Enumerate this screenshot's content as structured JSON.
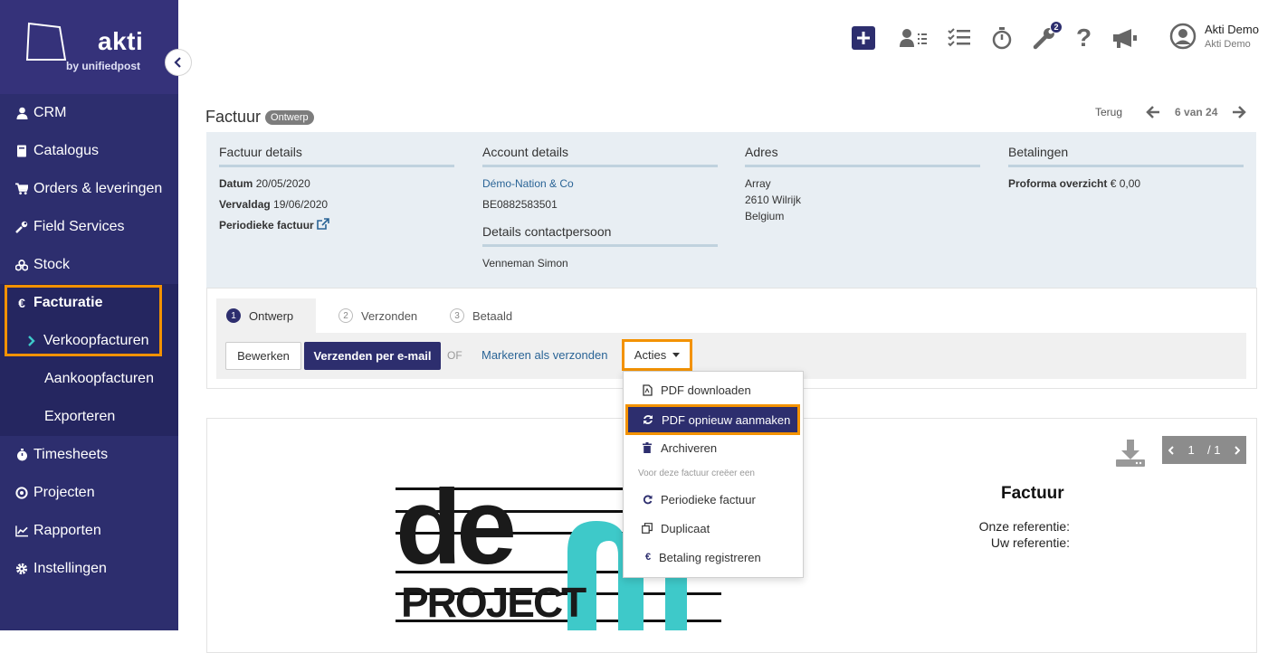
{
  "brand": {
    "name": "akti",
    "sub": "by unifiedpost"
  },
  "sidebar": {
    "items": [
      {
        "label": "CRM",
        "icon": "user-icon"
      },
      {
        "label": "Catalogus",
        "icon": "book-icon"
      },
      {
        "label": "Orders & leveringen",
        "icon": "cart-icon"
      },
      {
        "label": "Field Services",
        "icon": "wrench-icon"
      },
      {
        "label": "Stock",
        "icon": "cubes-icon"
      },
      {
        "label": "Facturatie",
        "icon": "euro-icon"
      },
      {
        "label": "Verkoopfacturen",
        "icon": "chevron-right-icon"
      },
      {
        "label": "Aankoopfacturen"
      },
      {
        "label": "Exporteren"
      },
      {
        "label": "Timesheets",
        "icon": "stopwatch-icon"
      },
      {
        "label": "Projecten",
        "icon": "target-icon"
      },
      {
        "label": "Rapporten",
        "icon": "chart-icon"
      },
      {
        "label": "Instellingen",
        "icon": "gear-icon"
      }
    ]
  },
  "header": {
    "badge_count": "2",
    "user_name": "Akti Demo",
    "user_company": "Akti Demo"
  },
  "page": {
    "title": "Factuur",
    "status": "Ontwerp",
    "back": "Terug",
    "position": "6 van 24"
  },
  "details": {
    "factuur": {
      "heading": "Factuur details",
      "datum_label": "Datum",
      "datum": "20/05/2020",
      "vervaldag_label": "Vervaldag",
      "vervaldag": "19/06/2020",
      "periodiek_label": "Periodieke factuur"
    },
    "account": {
      "heading": "Account details",
      "name": "Démo-Nation & Co",
      "vat": "BE0882583501",
      "contact_heading": "Details contactpersoon",
      "contact": "Venneman Simon"
    },
    "adres": {
      "heading": "Adres",
      "line1": "Array",
      "line2": "2610 Wilrijk",
      "line3": "Belgium"
    },
    "betalingen": {
      "heading": "Betalingen",
      "label": "Proforma overzicht",
      "value": "€ 0,00"
    }
  },
  "steps": [
    {
      "num": "1",
      "label": "Ontwerp"
    },
    {
      "num": "2",
      "label": "Verzonden"
    },
    {
      "num": "3",
      "label": "Betaald"
    }
  ],
  "actions": {
    "edit": "Bewerken",
    "send": "Verzenden per e-mail",
    "or": "OF",
    "mark": "Markeren als verzonden",
    "acties": "Acties"
  },
  "dropdown": {
    "pdf_download": "PDF downloaden",
    "pdf_regen": "PDF opnieuw aanmaken",
    "archive": "Archiveren",
    "section": "Voor deze factuur creëer een",
    "periodic": "Periodieke factuur",
    "duplicate": "Duplicaat",
    "payment": "Betaling registreren"
  },
  "preview": {
    "page": "1",
    "total": "/ 1",
    "title": "Factuur",
    "ref_ours": "Onze referentie:",
    "ref_yours": "Uw referentie:",
    "logo_top": "de",
    "logo_bottom": "project"
  }
}
